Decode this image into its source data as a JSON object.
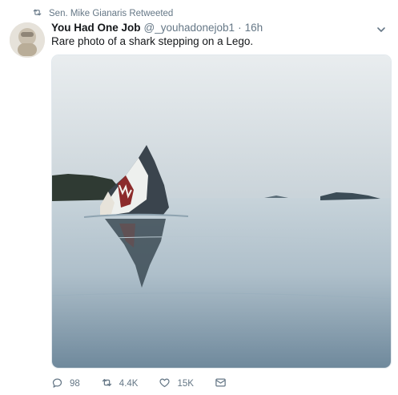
{
  "retweet": {
    "icon": "retweet-icon",
    "label": "Sen. Mike Gianaris Retweeted"
  },
  "tweet": {
    "author_name": "You Had One Job",
    "handle": "@_youhadonejob1",
    "separator": "·",
    "time": "16h",
    "text": "Rare photo of a shark stepping on a Lego."
  },
  "actions": {
    "reply": {
      "icon": "reply-icon",
      "count": "98"
    },
    "retweet": {
      "icon": "retweet-icon",
      "count": "4.4K"
    },
    "like": {
      "icon": "heart-icon",
      "count": "15K"
    },
    "message": {
      "icon": "envelope-icon"
    }
  },
  "colors": {
    "text_primary": "#14171a",
    "text_secondary": "#657786"
  }
}
